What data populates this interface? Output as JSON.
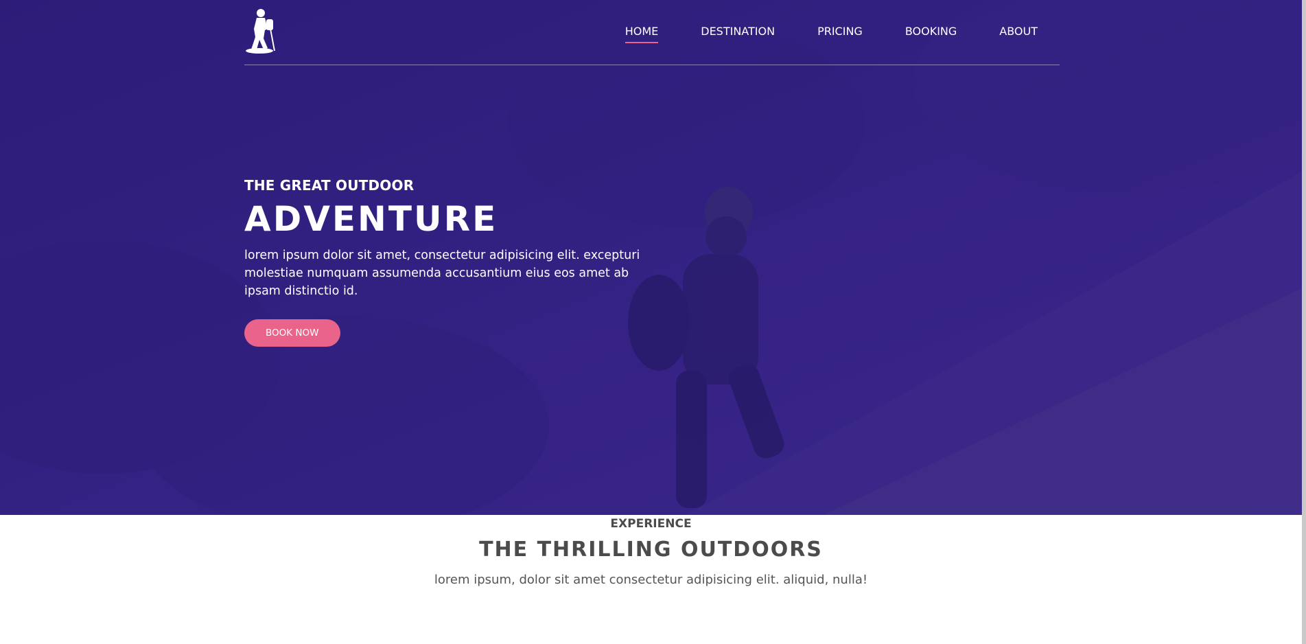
{
  "header": {
    "nav": [
      {
        "label": "HOME",
        "active": true
      },
      {
        "label": "DESTINATION",
        "active": false
      },
      {
        "label": "PRICING",
        "active": false
      },
      {
        "label": "BOOKING",
        "active": false
      },
      {
        "label": "ABOUT",
        "active": false
      }
    ],
    "logo_icon": "hiker-icon"
  },
  "hero": {
    "subtitle": "THE GREAT OUTDOOR",
    "title": "ADVENTURE",
    "text": "lorem ipsum dolor sit amet, consectetur adipisicing elit. excepturi molestiae numquam assumenda accusantium eius eos amet ab ipsam distinctio id.",
    "button_label": "BOOK NOW",
    "overlay_color": "#35247e",
    "accent_color": "#e9638a"
  },
  "experience": {
    "label": "EXPERIENCE",
    "title": "THE THRILLING OUTDOORS",
    "text": "lorem ipsum, dolor sit amet consectetur adipisicing elit. aliquid, nulla!"
  }
}
